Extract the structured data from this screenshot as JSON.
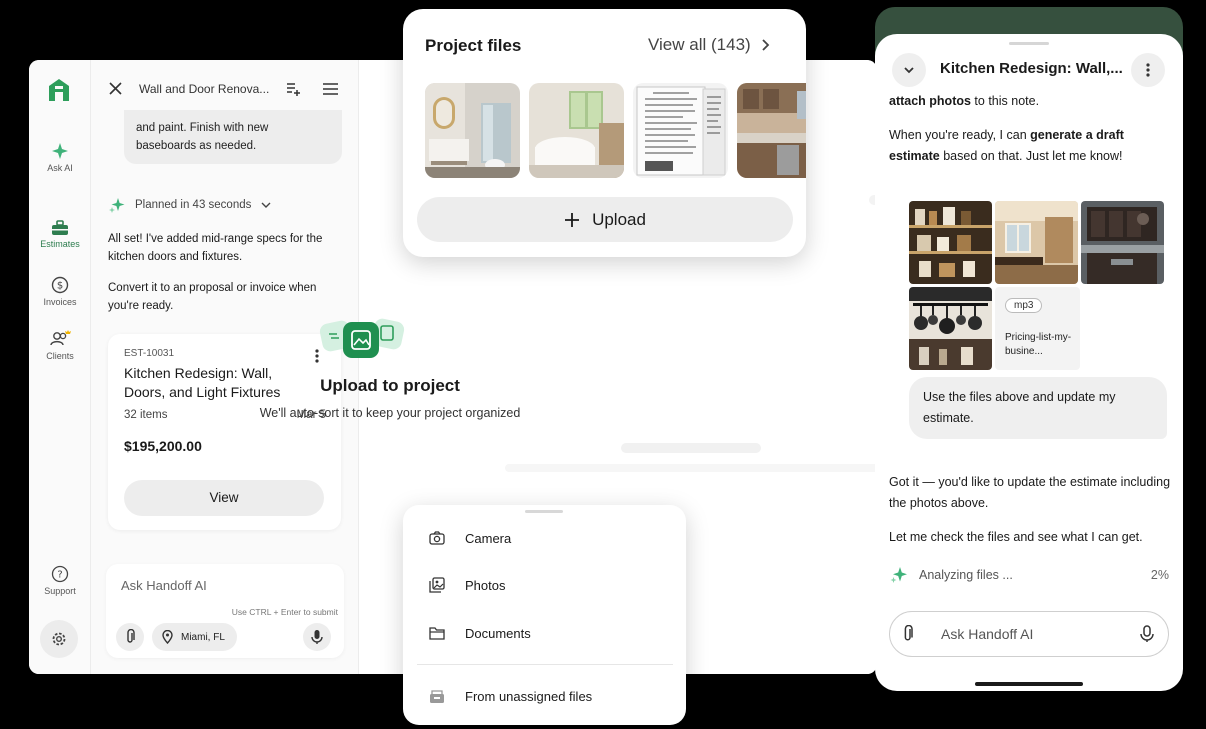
{
  "rail": {
    "ask_ai": "Ask AI",
    "estimates": "Estimates",
    "invoices": "Invoices",
    "clients": "Clients",
    "support": "Support"
  },
  "chat": {
    "title": "Wall and Door Renova...",
    "bubble_line1": "and paint. Finish with new",
    "bubble_line2": "baseboards as needed.",
    "planned": "Planned in 43 seconds",
    "msg1": "All set! I've added mid-range specs for the kitchen doors and fixtures.",
    "msg2": "Convert it to an proposal or invoice when you're ready.",
    "estimate": {
      "id": "EST-10031",
      "title": "Kitchen Redesign: Wall, Doors, and Light Fixtures",
      "items": "32 items",
      "date": "Mar 5",
      "amount": "$195,200.00",
      "view": "View"
    },
    "input_placeholder": "Ask Handoff AI",
    "input_hint": "Use CTRL + Enter to submit",
    "location": "Miami, FL"
  },
  "main": {
    "upload_title": "Upload to project",
    "upload_subtitle": "We'll auto-sort it to keep your project organized"
  },
  "project_files": {
    "title": "Project files",
    "view_all": "View all (143)",
    "upload": "Upload",
    "thumbnails": [
      "bathroom-photo",
      "bathtub-photo",
      "document-scan",
      "kitchen-photo"
    ]
  },
  "source_menu": {
    "camera": "Camera",
    "photos": "Photos",
    "documents": "Documents",
    "unassigned": "From unassigned files"
  },
  "mobile": {
    "title": "Kitchen Redesign: Wall,...",
    "p1_bold": "attach photos",
    "p1_rest": " to this note.",
    "p2_a": "When you're ready, I can ",
    "p2_bold": "generate a draft estimate",
    "p2_b": " based on that. Just let me know!",
    "file_tag": "mp3",
    "file_name": "Pricing-list-my-busine...",
    "user_msg": "Use the files above and update my estimate.",
    "reply1": "Got it — you'd like to update the estimate including the photos above.",
    "reply2": "Let me check the files and see what I can get.",
    "analyzing": "Analyzing files ...",
    "analyzing_pct": "2%",
    "input_placeholder": "Ask Handoff AI"
  },
  "colors": {
    "brand_green": "#2e9e5b",
    "dark_green": "#36503e",
    "background": "#000000"
  }
}
